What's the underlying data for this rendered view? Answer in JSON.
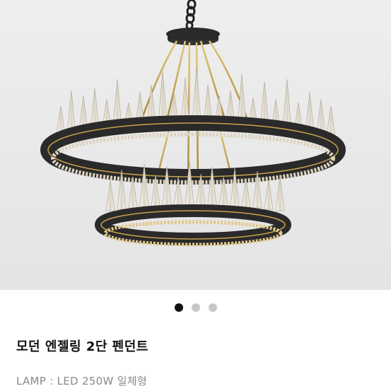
{
  "product": {
    "title": "모던 엔젤링 2단 펜던트",
    "spec": "LAMP : LED 250W 일체형"
  },
  "image": {
    "subject": "chandelier-photo"
  },
  "carousel": {
    "total": 3,
    "active_index": 0
  },
  "colors": {
    "background": "#e9e9e9",
    "ring_black": "#2a2a2a",
    "gold": "#c8a24a",
    "dot_active": "#111111",
    "dot_inactive": "#c7c7c7"
  }
}
